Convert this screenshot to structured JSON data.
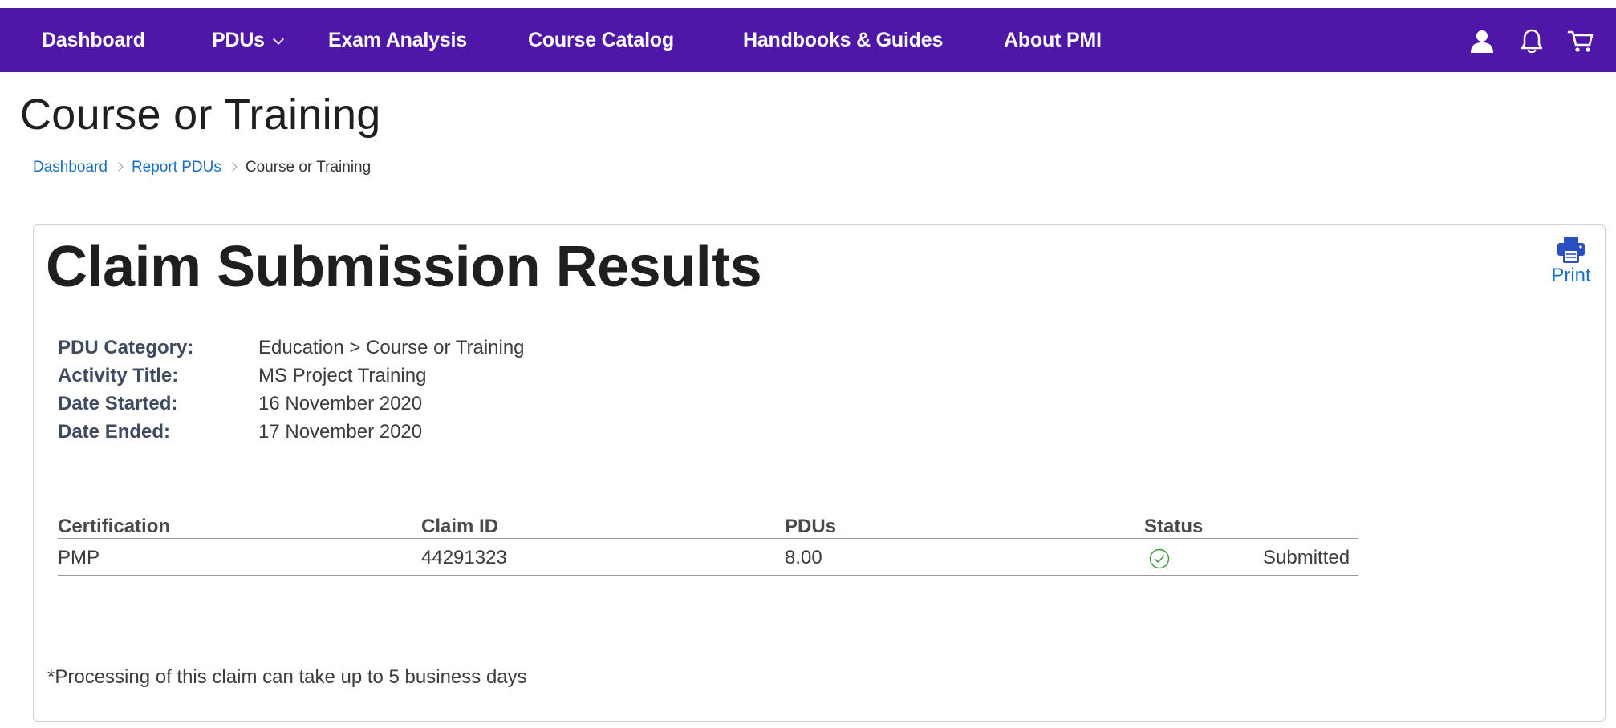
{
  "nav": {
    "items": [
      {
        "label": "Dashboard"
      },
      {
        "label": "PDUs"
      },
      {
        "label": "Exam Analysis"
      },
      {
        "label": "Course Catalog"
      },
      {
        "label": "Handbooks & Guides"
      },
      {
        "label": "About PMI"
      }
    ],
    "icons": [
      "user-icon",
      "bell-icon",
      "cart-icon"
    ],
    "color": "#4f17a8"
  },
  "page": {
    "title": "Course or Training"
  },
  "breadcrumb": {
    "items": [
      "Dashboard",
      "Report PDUs"
    ],
    "current": "Course or Training"
  },
  "card": {
    "title": "Claim Submission Results",
    "print_label": "Print",
    "print_icon": "printer-icon"
  },
  "details": [
    {
      "label": "PDU Category:",
      "value": "Education > Course or Training"
    },
    {
      "label": "Activity Title:",
      "value": "MS Project Training"
    },
    {
      "label": "Date Started:",
      "value": "16 November 2020"
    },
    {
      "label": "Date Ended:",
      "value": "17 November 2020"
    }
  ],
  "results": {
    "columns": [
      "Certification",
      "Claim ID",
      "PDUs",
      "Status"
    ],
    "rows": [
      {
        "certification": "PMP",
        "claim_id": "44291323",
        "pdus": "8.00",
        "status": "Submitted",
        "status_icon": "check-circle-icon"
      }
    ]
  },
  "note": "*Processing of this claim can take up to 5 business days",
  "colors": {
    "link": "#1a6fc4",
    "success": "#3a9a3a"
  }
}
